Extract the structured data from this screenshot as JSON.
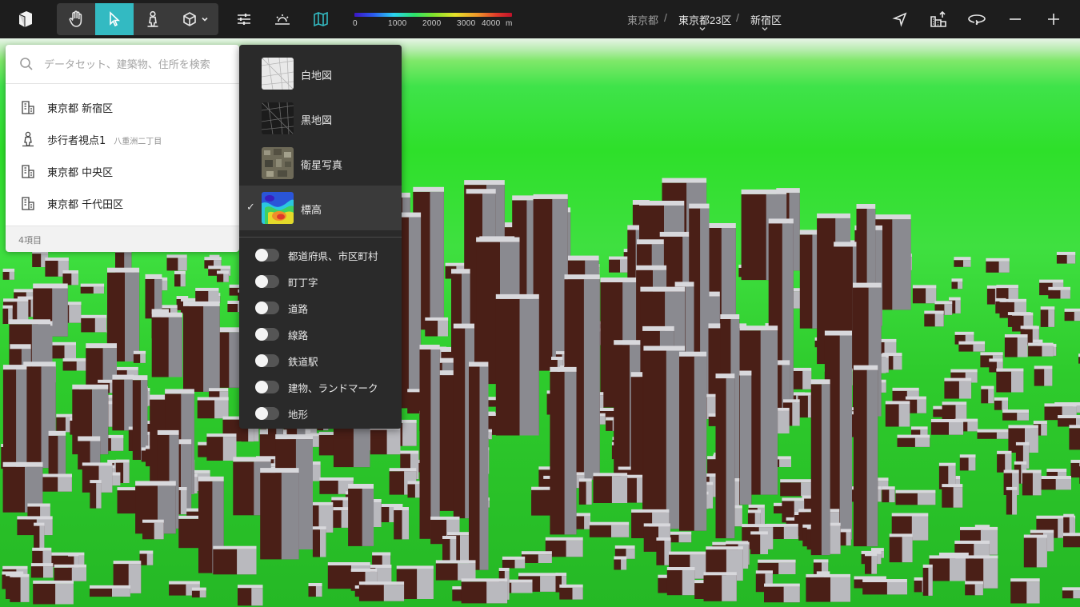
{
  "toolbar": {
    "logo_icon": "cube-logo-icon",
    "tools": [
      {
        "name": "pan",
        "icon": "hand-icon"
      },
      {
        "name": "select",
        "icon": "cursor-icon",
        "active": true
      },
      {
        "name": "pedestrian",
        "icon": "pedestrian-icon"
      },
      {
        "name": "sketch",
        "icon": "cube-icon",
        "has_dropdown": true
      }
    ],
    "settings_icon": "sliders-icon",
    "environment_icon": "sunrise-icon",
    "basemap_icon": "map-icon",
    "accent_color": "#33bac2"
  },
  "legend": {
    "ticks": [
      "0",
      "1000",
      "2000",
      "3000",
      "4000",
      "m"
    ]
  },
  "breadcrumb": {
    "items": [
      "東京都",
      "東京都23区",
      "新宿区"
    ],
    "separator": "/"
  },
  "view_controls": {
    "icons": [
      "location-arrow-icon",
      "export-icon",
      "orbit-icon",
      "zoom-out-icon",
      "zoom-in-icon"
    ]
  },
  "search": {
    "placeholder": "データセット、建築物、住所を検索",
    "results": [
      {
        "label": "東京都 新宿区",
        "sub": "",
        "icon": "building-dataset-icon"
      },
      {
        "label": "歩行者視点1",
        "sub": "八重洲二丁目",
        "icon": "pedestrian-icon"
      },
      {
        "label": "東京都 中央区",
        "sub": "",
        "icon": "building-dataset-icon"
      },
      {
        "label": "東京都 千代田区",
        "sub": "",
        "icon": "building-dataset-icon"
      }
    ],
    "count_label": "4項目"
  },
  "basemap_menu": {
    "basemaps": [
      {
        "label": "白地図",
        "selected": false
      },
      {
        "label": "黒地図",
        "selected": false
      },
      {
        "label": "衛星写真",
        "selected": false
      },
      {
        "label": "標高",
        "selected": true
      }
    ],
    "check_glyph": "✓",
    "layers": [
      {
        "label": "都道府県、市区町村",
        "on": false
      },
      {
        "label": "町丁字",
        "on": false
      },
      {
        "label": "道路",
        "on": false
      },
      {
        "label": "線路",
        "on": false
      },
      {
        "label": "鉄道駅",
        "on": false
      },
      {
        "label": "建物、ランドマーク",
        "on": false
      },
      {
        "label": "地形",
        "on": false
      }
    ]
  },
  "map": {
    "terrain_colors": [
      "#2ee02a",
      "#7fe86a",
      "#e8f4e8"
    ],
    "building_side_color": "#4a1f17",
    "building_top_color": "#d8d8dc"
  }
}
